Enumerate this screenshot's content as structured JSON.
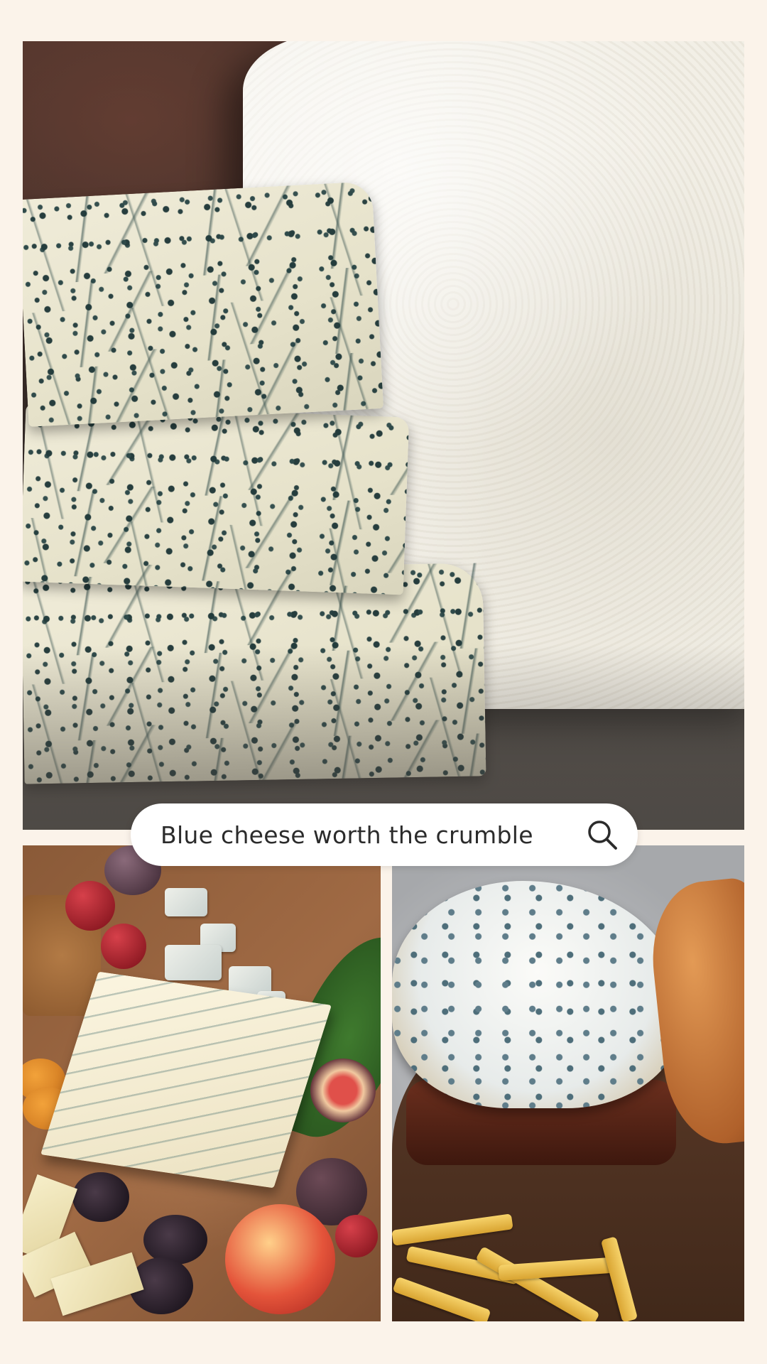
{
  "search": {
    "query": "Blue cheese worth the crumble",
    "icon": "search-icon"
  },
  "photos": [
    {
      "name": "blue-cheese-wedges-and-wheel"
    },
    {
      "name": "cheese-board"
    },
    {
      "name": "blue-cheese-burger"
    }
  ],
  "colors": {
    "background": "#fbf3ea",
    "search_bar": "#ffffff",
    "text": "#2b2b2b"
  }
}
